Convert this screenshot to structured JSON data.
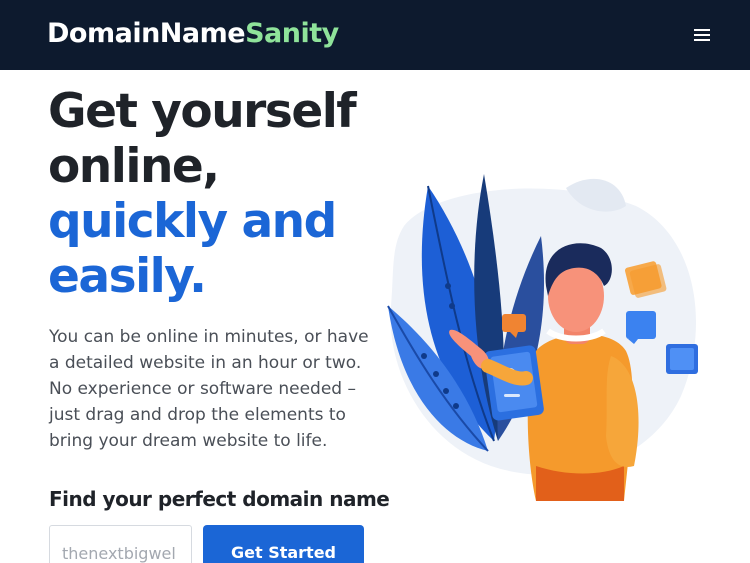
{
  "header": {
    "logo_part1": "DomainName",
    "logo_part2": "Sanity",
    "menu_icon": "hamburger-menu-icon"
  },
  "hero": {
    "headline_line1": "Get yourself",
    "headline_line2": "online,",
    "headline_line3": "quickly and",
    "headline_line4": "easily.",
    "description_lines": [
      "You can be online in minutes, or have",
      "a detailed website in an hour or two.",
      "No experience or software needed –",
      "just drag and drop the elements to",
      "bring your dream website to life."
    ]
  },
  "domain_search": {
    "heading": "Find your perfect domain name",
    "input_placeholder": "thenextbigwel",
    "input_value": "",
    "button_label": "Get Started"
  },
  "colors": {
    "navbar_bg": "#0d1a2e",
    "logo_accent": "#8fe39a",
    "brand_blue": "#1b66d6",
    "heading_text": "#1f2329",
    "body_text": "#4a4f57"
  }
}
